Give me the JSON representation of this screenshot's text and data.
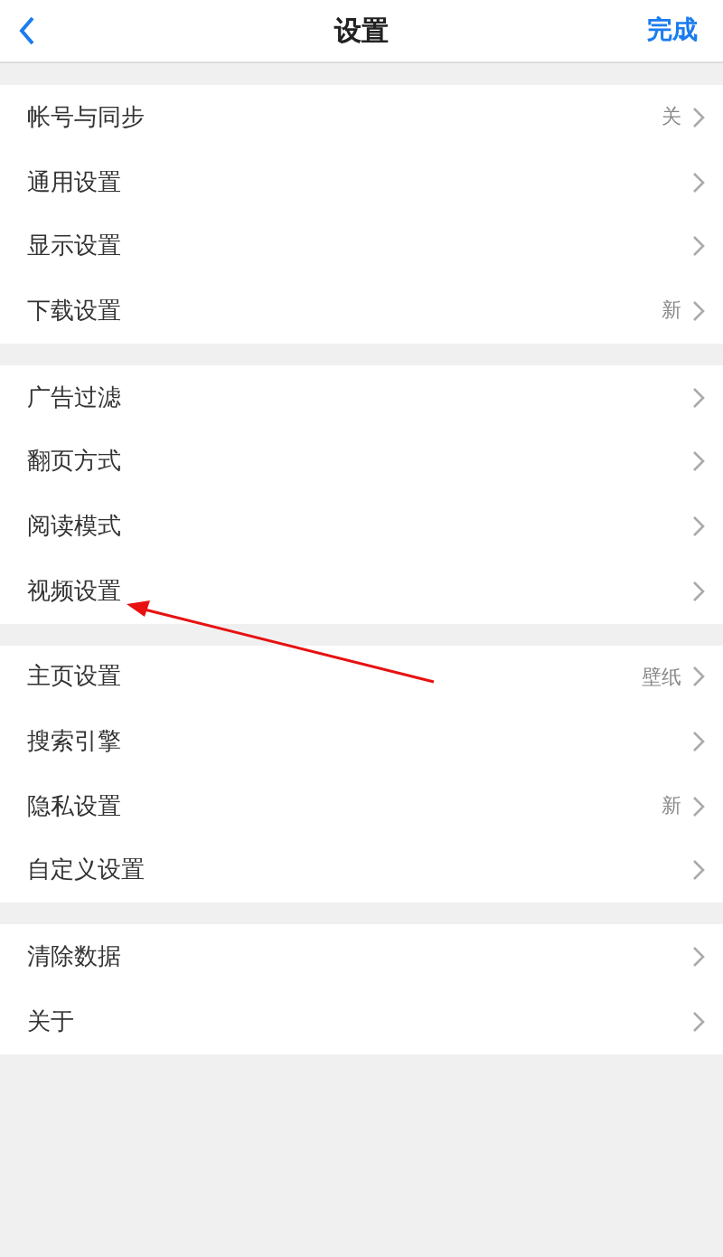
{
  "header": {
    "title": "设置",
    "done": "完成"
  },
  "sections": [
    {
      "items": [
        {
          "label": "帐号与同步",
          "value": "关"
        },
        {
          "label": "通用设置"
        },
        {
          "label": "显示设置"
        },
        {
          "label": "下载设置",
          "value": "新"
        }
      ]
    },
    {
      "items": [
        {
          "label": "广告过滤"
        },
        {
          "label": "翻页方式"
        },
        {
          "label": "阅读模式"
        },
        {
          "label": "视频设置"
        }
      ]
    },
    {
      "items": [
        {
          "label": "主页设置",
          "value": "壁纸"
        },
        {
          "label": "搜索引擎"
        },
        {
          "label": "隐私设置",
          "value": "新"
        },
        {
          "label": "自定义设置"
        }
      ]
    },
    {
      "items": [
        {
          "label": "清除数据"
        },
        {
          "label": "关于"
        }
      ]
    }
  ]
}
